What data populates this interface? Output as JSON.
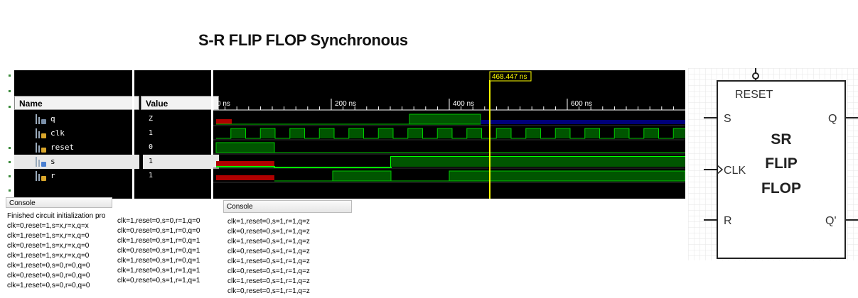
{
  "page_title": "S-R FLIP FLOP Synchronous",
  "waveform": {
    "name_header": "Name",
    "value_header": "Value",
    "cursor_label": "468.447 ns",
    "time_ticks": [
      "0 ns",
      "200 ns",
      "400 ns",
      "600 ns"
    ],
    "signals": [
      {
        "name": "q",
        "value": "Z",
        "selected": false
      },
      {
        "name": "clk",
        "value": "1",
        "selected": false
      },
      {
        "name": "reset",
        "value": "0",
        "selected": false
      },
      {
        "name": "s",
        "value": "1",
        "selected": true
      },
      {
        "name": "r",
        "value": "1",
        "selected": false
      }
    ],
    "colors": {
      "high": "#00c800",
      "red": "#c80000",
      "blue_z": "#000080",
      "cursor": "#ffff00"
    }
  },
  "console_left": {
    "tab": "Console",
    "lines": [
      "Finished circuit initialization pro",
      "clk=0,reset=1,s=x,r=x,q=x",
      "clk=1,reset=1,s=x,r=x,q=0",
      "clk=0,reset=1,s=x,r=x,q=0",
      "clk=1,reset=1,s=x,r=x,q=0",
      "clk=1,reset=0,s=0,r=0,q=0",
      "clk=0,reset=0,s=0,r=0,q=0",
      "clk=1,reset=0,s=0,r=0,q=0"
    ]
  },
  "console_mid": {
    "lines": [
      "clk=1,reset=0,s=0,r=1,q=0",
      "clk=0,reset=0,s=1,r=0,q=0",
      "clk=1,reset=0,s=1,r=0,q=1",
      "clk=0,reset=0,s=1,r=0,q=1",
      "clk=1,reset=0,s=1,r=0,q=1",
      "clk=1,reset=0,s=1,r=1,q=1",
      "clk=0,reset=0,s=1,r=1,q=1"
    ]
  },
  "console_right": {
    "tab": "Console",
    "lines": [
      "clk=1,reset=0,s=1,r=1,q=z",
      "clk=0,reset=0,s=1,r=1,q=z",
      "clk=1,reset=0,s=1,r=1,q=z",
      "clk=0,reset=0,s=1,r=1,q=z",
      "clk=1,reset=0,s=1,r=1,q=z",
      "clk=0,reset=0,s=1,r=1,q=z",
      "clk=1,reset=0,s=1,r=1,q=z",
      "clk=0,reset=0,s=1,r=1,q=z"
    ]
  },
  "schematic": {
    "reset_label": "RESET",
    "s_label": "S",
    "clk_label": "CLK",
    "r_label": "R",
    "q_label": "Q",
    "qbar_label": "Q'",
    "body_line1": "SR",
    "body_line2": "FLIP",
    "body_line3": "FLOP"
  }
}
